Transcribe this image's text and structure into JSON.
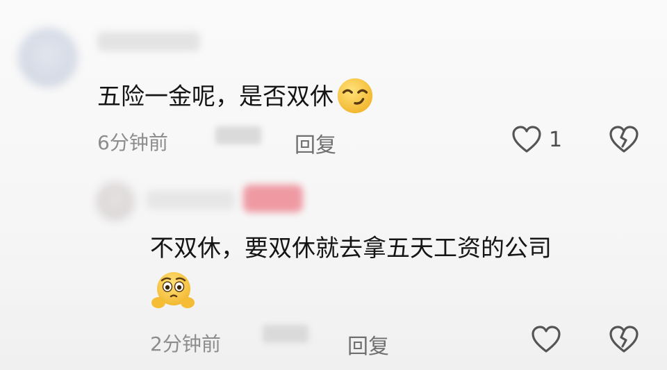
{
  "comments": [
    {
      "text": "五险一金呢，是否双休",
      "emoji": "smirk-emoji",
      "time": "6分钟前",
      "reply_label": "回复",
      "like_count": "1",
      "like_icon": "heart-outline-icon",
      "dislike_icon": "broken-heart-icon"
    }
  ],
  "replies": [
    {
      "text": "不双休，要双休就去拿五天工资的公司",
      "emoji": "pleading-emoji",
      "time": "2分钟前",
      "reply_label": "回复",
      "like_icon": "heart-outline-icon",
      "dislike_icon": "broken-heart-icon"
    }
  ],
  "colors": {
    "text": "#151515",
    "meta": "#8c8c8c",
    "icon": "#555555",
    "badge": "#ef9aa3",
    "emoji_yellow": "#f6c33b"
  }
}
